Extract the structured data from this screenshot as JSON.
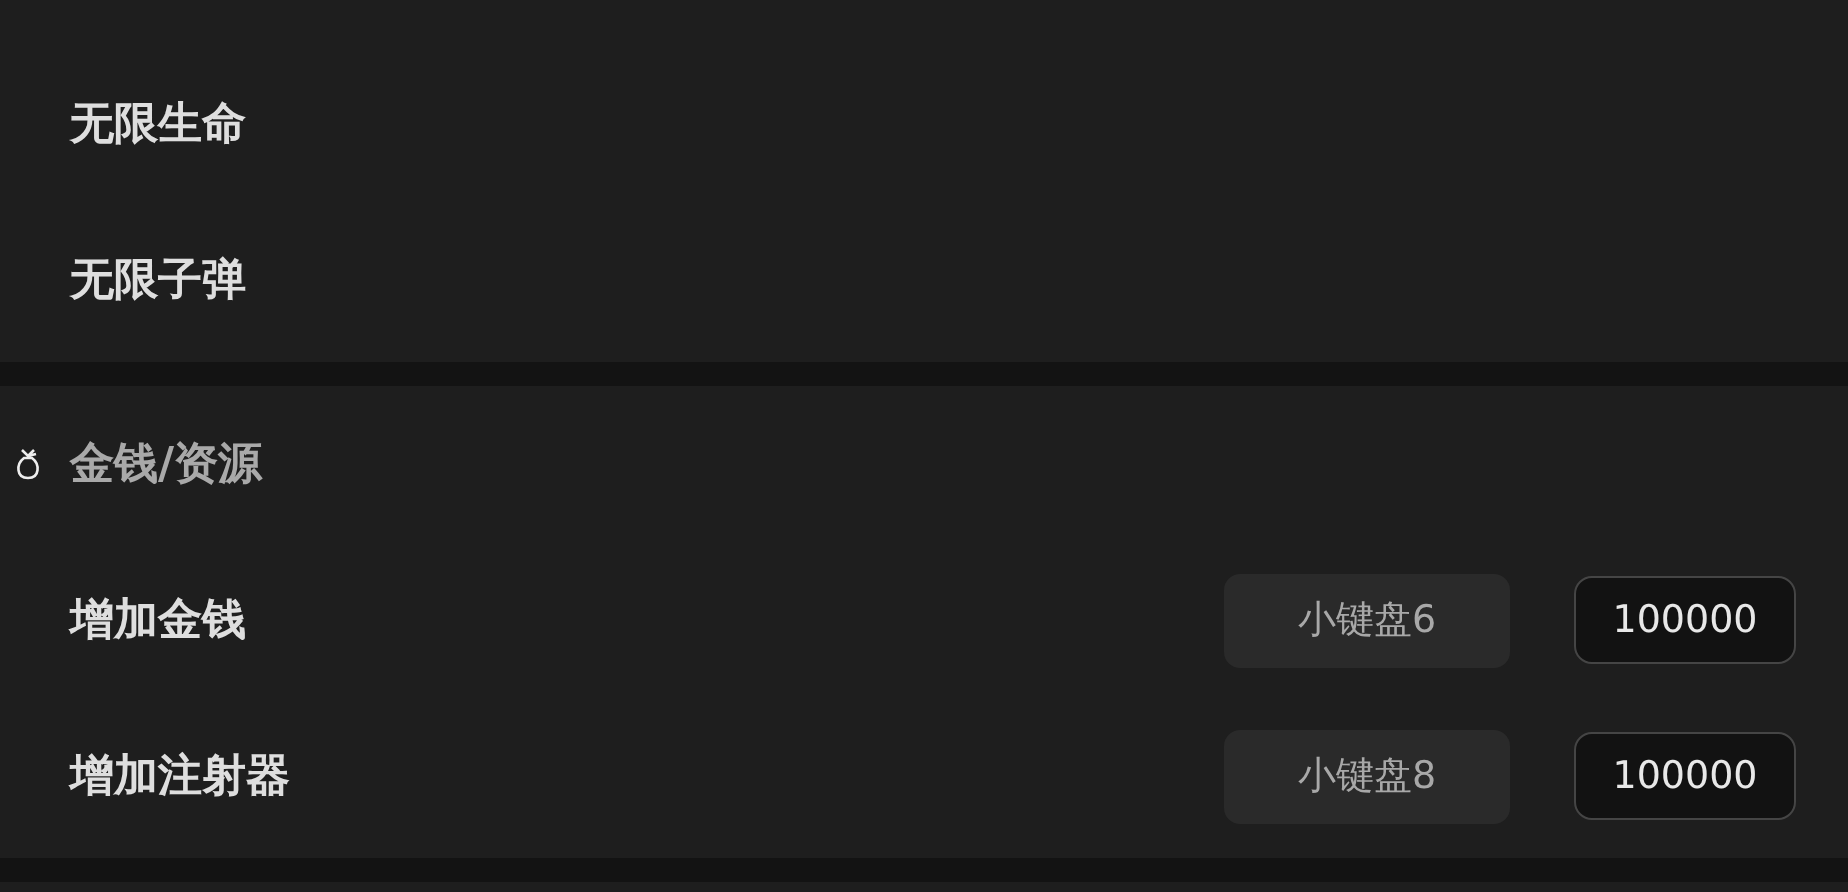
{
  "sections": [
    {
      "rows": [
        {
          "label": "无限生命"
        },
        {
          "label": "无限子弹"
        }
      ]
    },
    {
      "title": "金钱/资源",
      "rows": [
        {
          "label": "增加金钱",
          "hotkey": "小键盘6",
          "value": "100000"
        },
        {
          "label": "增加注射器",
          "hotkey": "小键盘8",
          "value": "100000"
        }
      ]
    }
  ]
}
